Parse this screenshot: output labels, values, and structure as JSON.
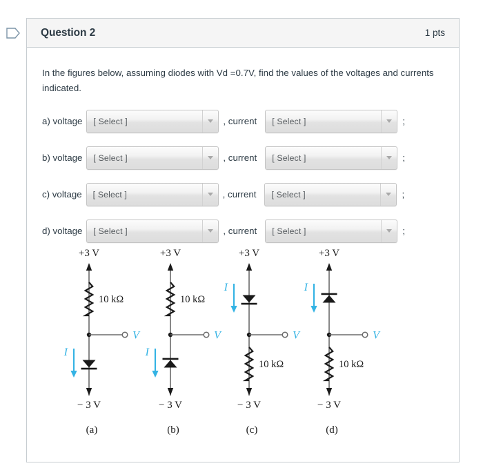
{
  "header": {
    "flag_icon": "flag-outline-icon",
    "title": "Question 2",
    "points": "1 pts"
  },
  "prompt": {
    "text": "In the figures below, assuming diodes with Vd =0.7V, find the values of the voltages and currents indicated."
  },
  "select_placeholder": "[ Select ]",
  "answer_rows": [
    {
      "id": "a",
      "label": "a) voltage",
      "voltage_value": "[ Select ]",
      "mid_label": ", current",
      "current_value": "[ Select ]",
      "end_label": ";"
    },
    {
      "id": "b",
      "label": "b) voltage",
      "voltage_value": "[ Select ]",
      "mid_label": ", current",
      "current_value": "[ Select ]",
      "end_label": ";"
    },
    {
      "id": "c",
      "label": "c) voltage",
      "voltage_value": "[ Select ]",
      "mid_label": ", current",
      "current_value": "[ Select ]",
      "end_label": ";"
    },
    {
      "id": "d",
      "label": "d) voltage",
      "voltage_value": "[ Select ]",
      "mid_label": ", current",
      "current_value": "[ Select ]",
      "end_label": ";"
    }
  ],
  "figure": {
    "accent_blue": "#34b3e4",
    "wire_color": "#6b6b6b",
    "ink_color": "#1a1a1a",
    "circuits": [
      {
        "key": "a",
        "caption": "(a)",
        "top_rail": "+3 V",
        "bottom_rail": "− 3 V",
        "resistor_label": "10 kΩ",
        "node_label": "V",
        "current_label": "I",
        "top_element": "resistor",
        "bottom_element": "diode",
        "diode_orientation": "cathode-bottom"
      },
      {
        "key": "b",
        "caption": "(b)",
        "top_rail": "+3 V",
        "bottom_rail": "− 3 V",
        "resistor_label": "10 kΩ",
        "node_label": "V",
        "current_label": "I",
        "top_element": "resistor",
        "bottom_element": "diode",
        "diode_orientation": "cathode-top"
      },
      {
        "key": "c",
        "caption": "(c)",
        "top_rail": "+3 V",
        "bottom_rail": "− 3 V",
        "resistor_label": "10 kΩ",
        "node_label": "V",
        "current_label": "I",
        "top_element": "diode",
        "bottom_element": "resistor",
        "diode_orientation": "cathode-bottom"
      },
      {
        "key": "d",
        "caption": "(d)",
        "top_rail": "+3 V",
        "bottom_rail": "− 3 V",
        "resistor_label": "10 kΩ",
        "node_label": "V",
        "current_label": "I",
        "top_element": "diode",
        "bottom_element": "resistor",
        "diode_orientation": "cathode-top"
      }
    ]
  }
}
